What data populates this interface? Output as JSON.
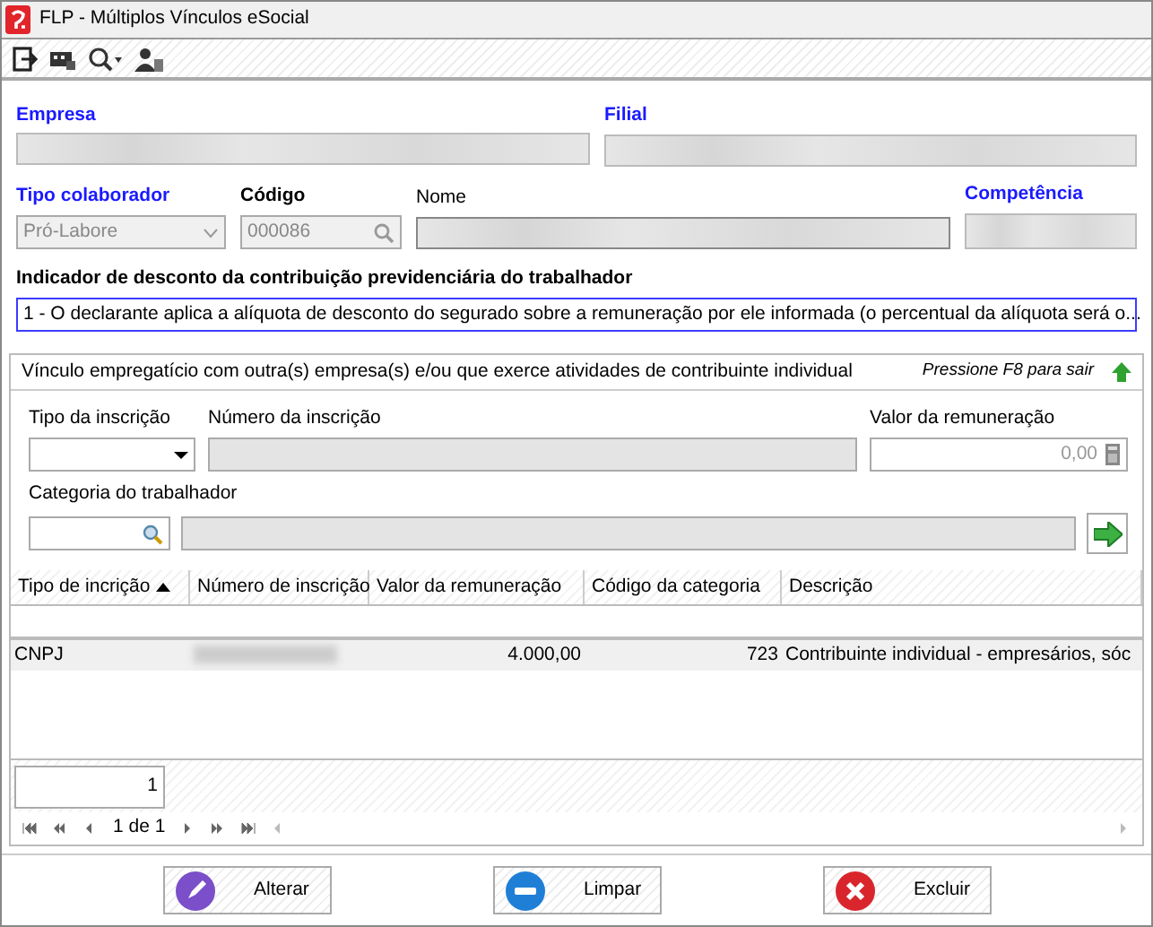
{
  "window": {
    "title": "FLP - Múltiplos Vínculos eSocial"
  },
  "form": {
    "empresa": {
      "label": "Empresa",
      "required": true
    },
    "filial": {
      "label": "Filial",
      "required": true
    },
    "tipo_colaborador": {
      "label": "Tipo colaborador",
      "required": true,
      "value": "Pró-Labore",
      "disabled": true
    },
    "codigo": {
      "label": "Código",
      "required": false,
      "value": "000086",
      "disabled": true
    },
    "nome": {
      "label": "Nome"
    },
    "competencia": {
      "label": "Competência",
      "required": true
    },
    "indicador": {
      "label": "Indicador de desconto da contribuição previdenciária do trabalhador",
      "value": "1 - O declarante aplica a alíquota de desconto do segurado sobre a remuneração por ele informada (o percentual da alíquota será o..."
    }
  },
  "panel": {
    "title": "Vínculo empregatício com outra(s) empresa(s) e/ou que exerce atividades de contribuinte individual",
    "hint": "Pressione F8 para sair",
    "tipo_inscricao": {
      "label": "Tipo da inscrição"
    },
    "numero_inscricao": {
      "label": "Número da inscrição"
    },
    "valor_remuneracao": {
      "label": "Valor da remuneração",
      "value": "0,00"
    },
    "categoria": {
      "label": "Categoria do trabalhador"
    }
  },
  "table": {
    "columns": [
      {
        "label": "Tipo de incrição",
        "sorted": true
      },
      {
        "label": "Número de inscrição",
        "sorted": false
      },
      {
        "label": "Valor da remuneração",
        "sorted": false
      },
      {
        "label": "Código da categoria",
        "sorted": false
      },
      {
        "label": "Descrição",
        "sorted": false
      }
    ],
    "rows": [
      {
        "selected": true,
        "cells": [
          "CNPJ",
          null,
          "4.000,00",
          "723",
          "Contribuinte individual - empresários, sóc"
        ]
      }
    ],
    "count": "1",
    "pager": "1 de 1"
  },
  "buttons": [
    {
      "kind": "edit",
      "label": "Alterar"
    },
    {
      "kind": "clear",
      "label": "Limpar"
    },
    {
      "kind": "delete",
      "label": "Excluir"
    }
  ]
}
